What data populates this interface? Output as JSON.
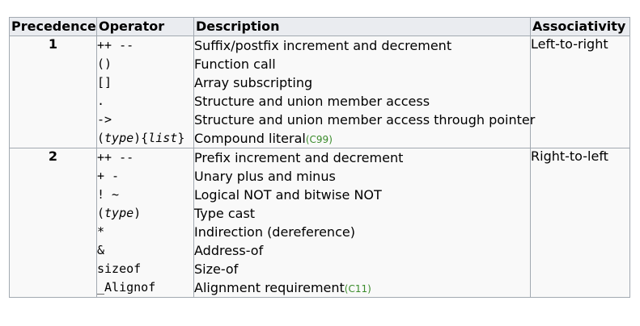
{
  "headers": {
    "precedence": "Precedence",
    "operator": "Operator",
    "description": "Description",
    "associativity": "Associativity"
  },
  "groups": [
    {
      "precedence": "1",
      "associativity": "Left-to-right",
      "rows": [
        {
          "op_parts": [
            {
              "t": "++ --",
              "i": false
            }
          ],
          "desc": "Suffix/postfix increment and decrement",
          "std": ""
        },
        {
          "op_parts": [
            {
              "t": "()",
              "i": false
            }
          ],
          "desc": "Function call",
          "std": ""
        },
        {
          "op_parts": [
            {
              "t": "[]",
              "i": false
            }
          ],
          "desc": "Array subscripting",
          "std": ""
        },
        {
          "op_parts": [
            {
              "t": ".",
              "i": false
            }
          ],
          "desc": "Structure and union member access",
          "std": ""
        },
        {
          "op_parts": [
            {
              "t": "->",
              "i": false
            }
          ],
          "desc": "Structure and union member access through pointer",
          "std": ""
        },
        {
          "op_parts": [
            {
              "t": "(",
              "i": false
            },
            {
              "t": "type",
              "i": true
            },
            {
              "t": "){",
              "i": false
            },
            {
              "t": "list",
              "i": true
            },
            {
              "t": "}",
              "i": false
            }
          ],
          "desc": "Compound literal",
          "std": "(C99)"
        }
      ]
    },
    {
      "precedence": "2",
      "associativity": "Right-to-left",
      "rows": [
        {
          "op_parts": [
            {
              "t": "++ --",
              "i": false
            }
          ],
          "desc": "Prefix increment and decrement",
          "std": ""
        },
        {
          "op_parts": [
            {
              "t": "+ -",
              "i": false
            }
          ],
          "desc": "Unary plus and minus",
          "std": ""
        },
        {
          "op_parts": [
            {
              "t": "! ~",
              "i": false
            }
          ],
          "desc": "Logical NOT and bitwise NOT",
          "std": ""
        },
        {
          "op_parts": [
            {
              "t": "(",
              "i": false
            },
            {
              "t": "type",
              "i": true
            },
            {
              "t": ")",
              "i": false
            }
          ],
          "desc": "Type cast",
          "std": ""
        },
        {
          "op_parts": [
            {
              "t": "*",
              "i": false
            }
          ],
          "desc": "Indirection (dereference)",
          "std": ""
        },
        {
          "op_parts": [
            {
              "t": "&",
              "i": false
            }
          ],
          "desc": "Address-of",
          "std": ""
        },
        {
          "op_parts": [
            {
              "t": "sizeof",
              "i": false
            }
          ],
          "desc": "Size-of",
          "std": ""
        },
        {
          "op_parts": [
            {
              "t": "_Alignof",
              "i": false
            }
          ],
          "desc": "Alignment requirement",
          "std": "(C11)"
        }
      ]
    }
  ],
  "colors": {
    "header_bg": "#eaecf0",
    "cell_bg": "#f9f9f9",
    "border": "#a2a9b1",
    "standard_tag": "#3a8b2a"
  }
}
